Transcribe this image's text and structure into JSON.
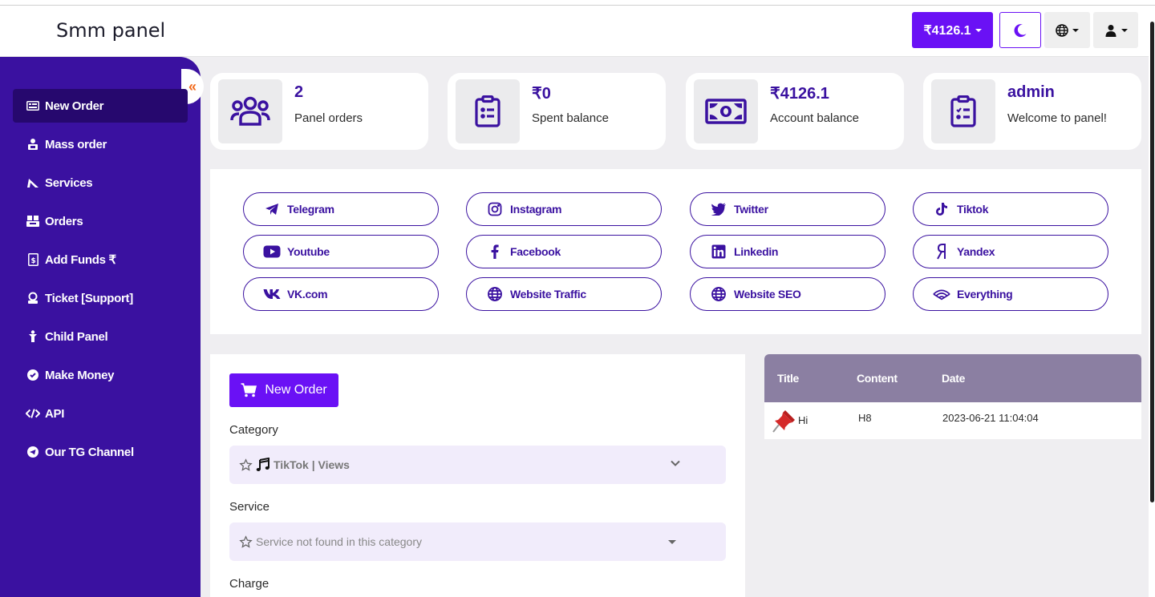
{
  "header": {
    "brand": "Smm panel",
    "balance": "₹4126.1"
  },
  "sidebar": {
    "items": [
      {
        "label": "New Order",
        "icon": "new-order-icon"
      },
      {
        "label": "Mass order",
        "icon": "mass-order-icon"
      },
      {
        "label": "Services",
        "icon": "services-icon"
      },
      {
        "label": "Orders",
        "icon": "orders-icon"
      },
      {
        "label": "Add Funds ₹",
        "icon": "add-funds-icon"
      },
      {
        "label": "Ticket [Support]",
        "icon": "ticket-icon"
      },
      {
        "label": "Child Panel",
        "icon": "child-panel-icon"
      },
      {
        "label": "Make Money",
        "icon": "make-money-icon"
      },
      {
        "label": "API",
        "icon": "api-icon"
      },
      {
        "label": "Our TG Channel",
        "icon": "telegram-channel-icon"
      }
    ],
    "collapse": "«"
  },
  "stats": [
    {
      "value": "2",
      "label": "Panel orders",
      "icon": "users-icon"
    },
    {
      "value": "₹0",
      "label": "Spent balance",
      "icon": "clipboard-icon"
    },
    {
      "value": "₹4126.1",
      "label": "Account balance",
      "icon": "money-icon"
    },
    {
      "value": "admin",
      "label": "Welcome to panel!",
      "icon": "clipboard-check-icon"
    }
  ],
  "categories": [
    {
      "label": "Telegram",
      "icon": "telegram-icon"
    },
    {
      "label": "Instagram",
      "icon": "instagram-icon"
    },
    {
      "label": "Twitter",
      "icon": "twitter-icon"
    },
    {
      "label": "Tiktok",
      "icon": "tiktok-icon"
    },
    {
      "label": "Youtube",
      "icon": "youtube-icon"
    },
    {
      "label": "Facebook",
      "icon": "facebook-icon"
    },
    {
      "label": "Linkedin",
      "icon": "linkedin-icon"
    },
    {
      "label": "Yandex",
      "icon": "yandex-icon"
    },
    {
      "label": "VK.com",
      "icon": "vk-icon"
    },
    {
      "label": "Website Traffic",
      "icon": "globe-icon"
    },
    {
      "label": "Website SEO",
      "icon": "globe-icon"
    },
    {
      "label": "Everything",
      "icon": "wifi-icon"
    }
  ],
  "form": {
    "button": "New Order",
    "category_label": "Category",
    "category_value": "TikTok | Views",
    "service_label": "Service",
    "service_value": "Service not found in this category",
    "charge_label": "Charge"
  },
  "news": {
    "headers": [
      "Title",
      "Content",
      "Date"
    ],
    "rows": [
      {
        "title": "Hi",
        "content": "H8",
        "date": "2023-06-21 11:04:04"
      }
    ]
  },
  "colors": {
    "accent": "#6a11f5",
    "sidebar": "#3a11a0",
    "sidebar_active": "#26086e",
    "news_header": "#8b7fa2"
  }
}
